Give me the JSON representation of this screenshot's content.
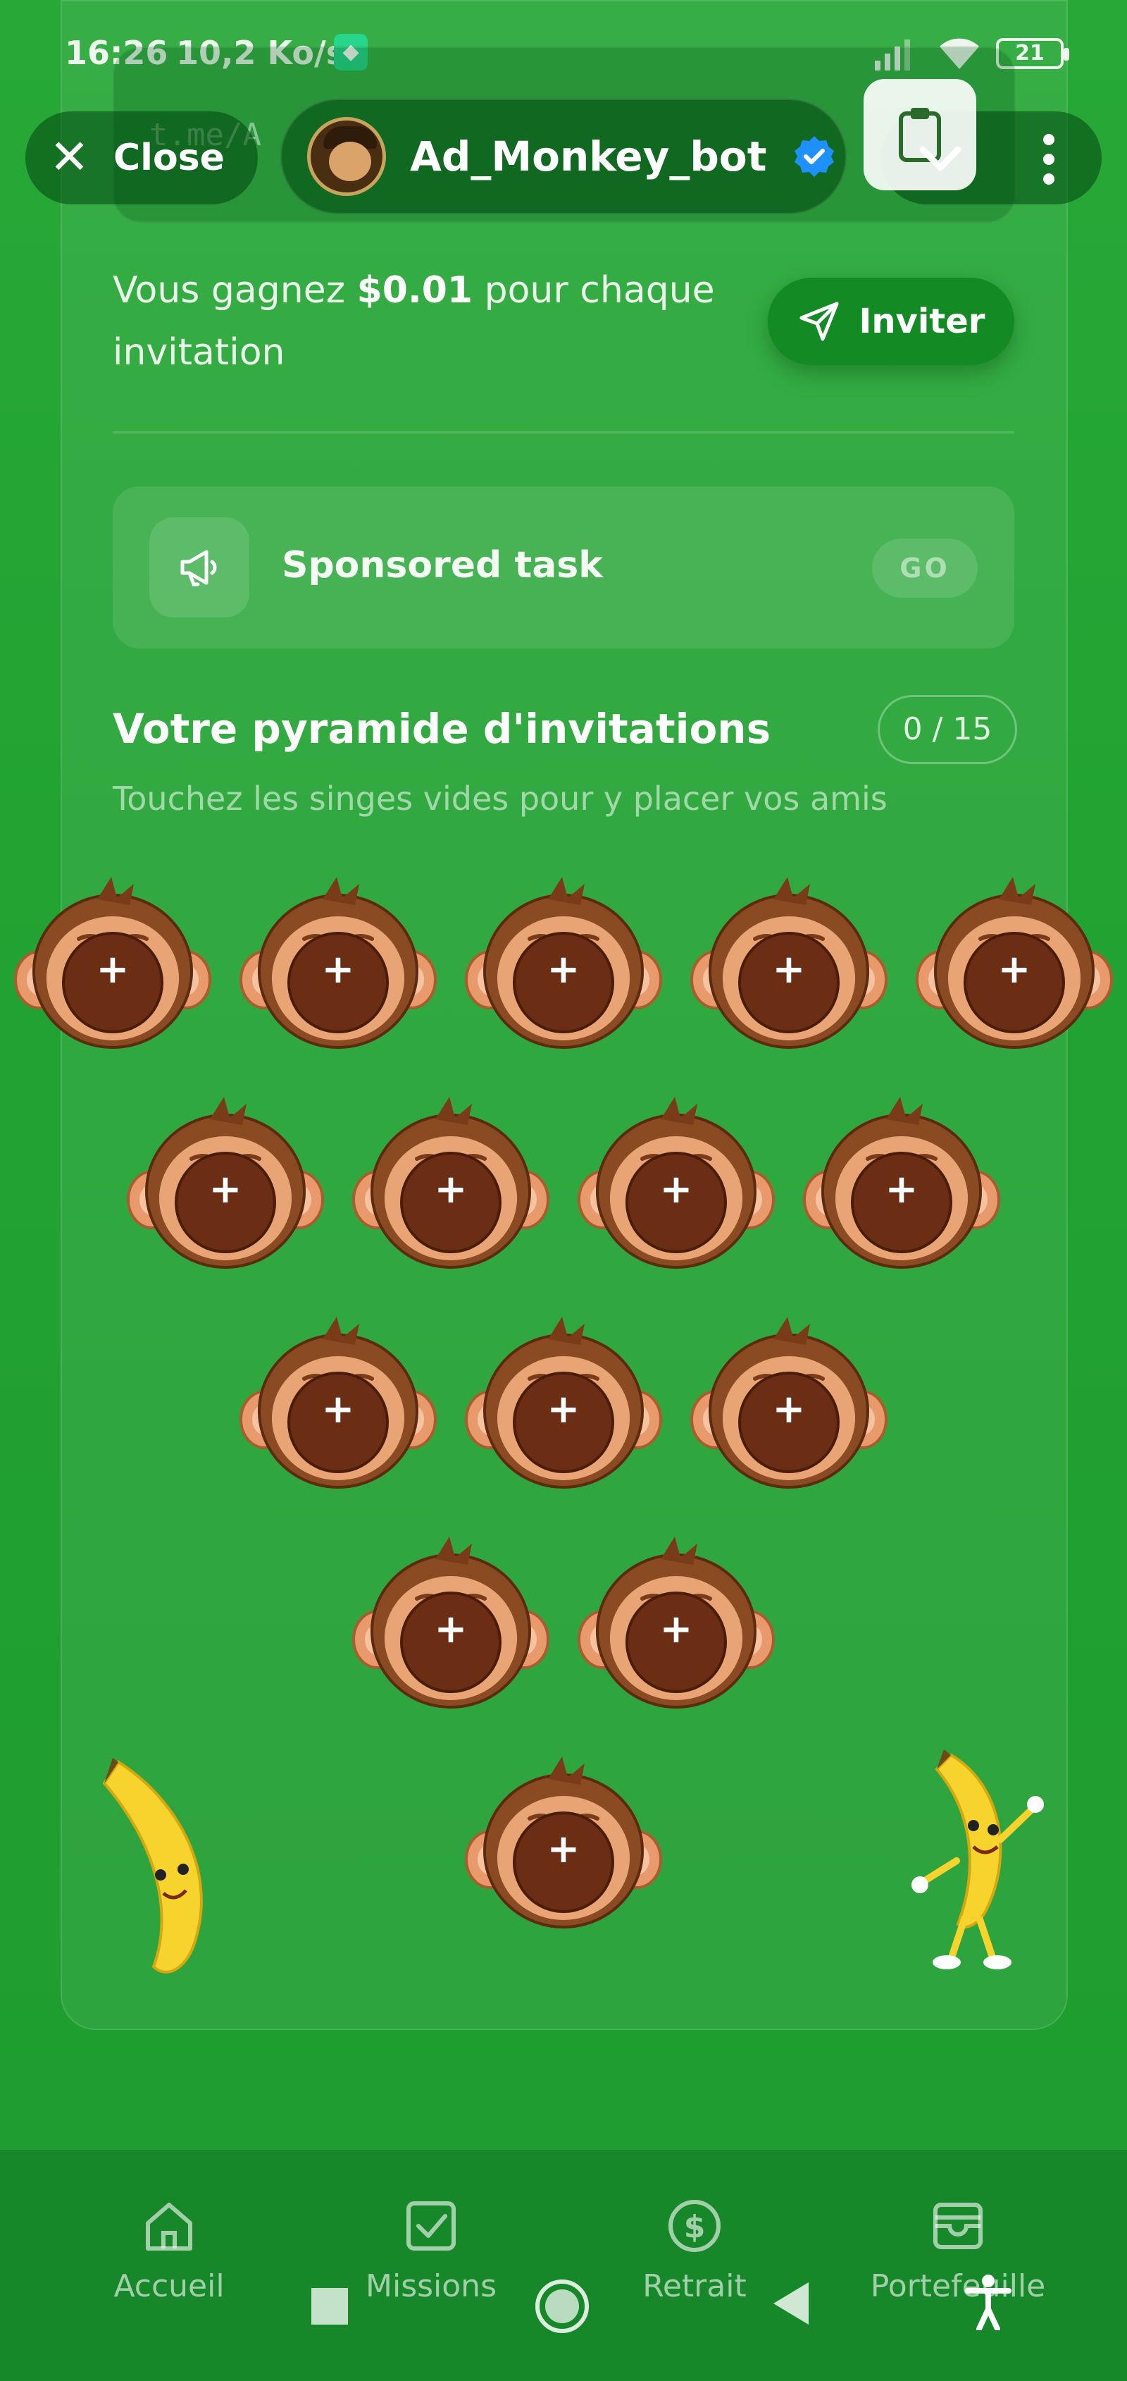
{
  "status_bar": {
    "time": "16:26",
    "speed": "10,2 Ko/s",
    "battery": "21"
  },
  "browser": {
    "url": "t.me/A",
    "close_label": "Close",
    "bot_name": "Ad_Monkey_bot"
  },
  "referral": {
    "earn_prefix": "Vous gagnez ",
    "earn_amount": "$0.01",
    "earn_suffix": " pour chaque invitation",
    "invite_label": "Inviter"
  },
  "sponsored": {
    "label": "Sponsored task",
    "go_label": "GO"
  },
  "pyramid": {
    "title": "Votre pyramide d'invitations",
    "count": "0 / 15",
    "subtitle": "Touchez les singes vides pour y placer vos amis",
    "slot_symbol": "+",
    "rows": [
      5,
      4,
      3,
      2,
      1
    ],
    "filled": 0,
    "total": 15
  },
  "bottom_nav": {
    "items": [
      {
        "label": "Accueil",
        "icon": "home-icon"
      },
      {
        "label": "Missions",
        "icon": "checkbox-icon"
      },
      {
        "label": "Retrait",
        "icon": "dollar-icon"
      },
      {
        "label": "Portefeuille",
        "icon": "wallet-icon"
      }
    ]
  },
  "colors": {
    "background": "#22a332",
    "nav_background": "#17882a",
    "invite_button": "#138a24",
    "monkey_face": "#6b2e14",
    "verified": "#1e90ff"
  }
}
